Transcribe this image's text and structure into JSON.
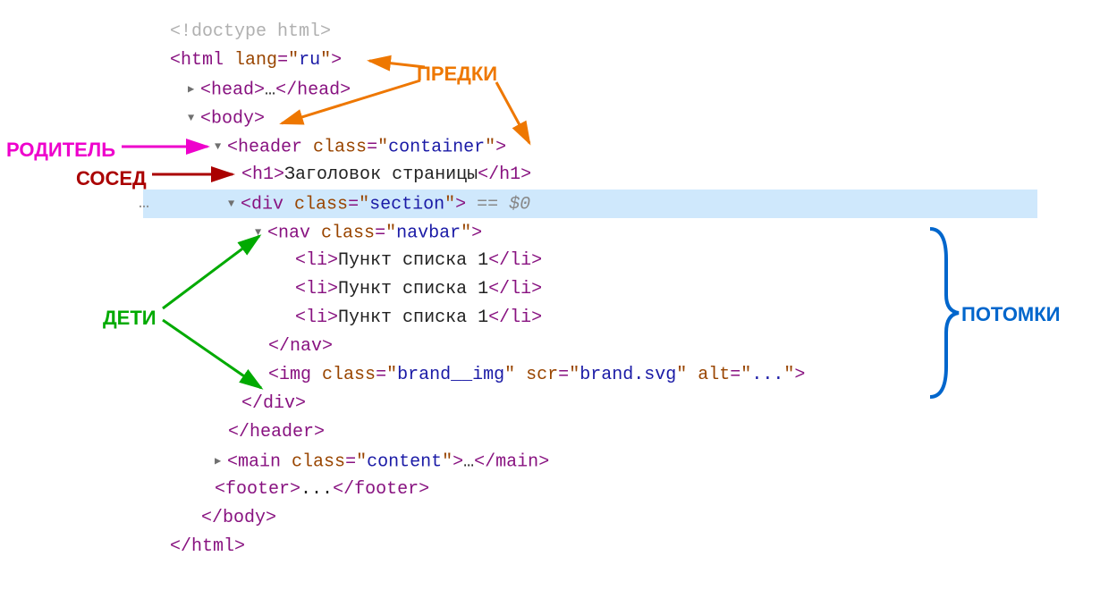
{
  "labels": {
    "predki": "ПРЕДКИ",
    "roditel": "РОДИТЕЛЬ",
    "sosed": "СОСЕД",
    "deti": "ДЕТИ",
    "potomki": "ПОТОМКИ"
  },
  "code": {
    "doctype": "<!doctype html>",
    "html_open_full": "<html lang=\"ru\">",
    "html_tag": "html",
    "html_attr": "lang",
    "html_val": "ru",
    "head_tag": "head",
    "head_ellipsis": "…",
    "body_tag": "body",
    "header_tag": "header",
    "header_attr": "class",
    "header_val": "container",
    "h1_tag": "h1",
    "h1_text": "Заголовок страницы",
    "div_tag": "div",
    "div_attr": "class",
    "div_val": "section",
    "dollar": " == $0",
    "nav_tag": "nav",
    "nav_attr": "class",
    "nav_val": "navbar",
    "li_tag": "li",
    "li1_text": "Пункт списка 1",
    "li2_text": "Пункт списка 1",
    "li3_text": "Пункт списка 1",
    "img_tag": "img",
    "img_attr1": "class",
    "img_val1": "brand__img",
    "img_attr2": "scr",
    "img_val2": "brand.svg",
    "img_attr3": "alt",
    "img_val3": "...",
    "main_tag": "main",
    "main_attr": "class",
    "main_val": "content",
    "main_ellipsis": "…",
    "footer_tag": "footer",
    "footer_text": "...",
    "badge_ellipsis": "…"
  }
}
